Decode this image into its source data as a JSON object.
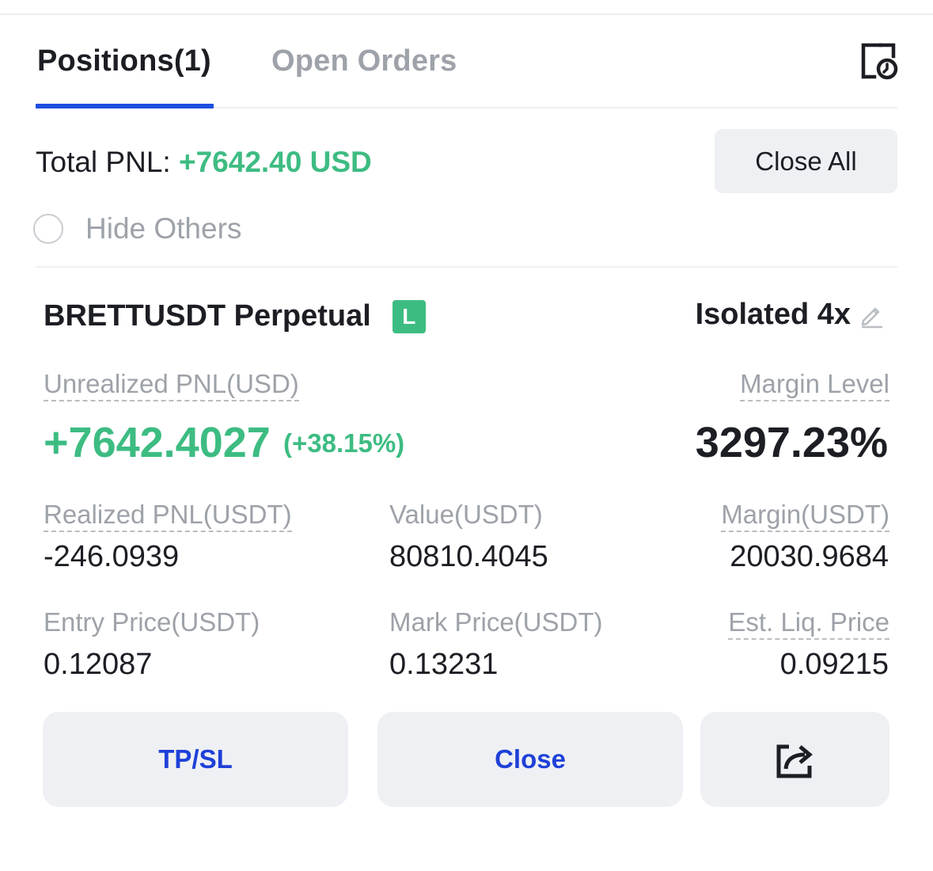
{
  "tabs": [
    {
      "label": "Positions(1)",
      "active": true
    },
    {
      "label": "Open Orders",
      "active": false
    }
  ],
  "summary": {
    "total_pnl_label": "Total PNL: ",
    "total_pnl_value": "+7642.40 USD",
    "close_all_label": "Close All",
    "hide_others_label": "Hide Others",
    "hide_others_checked": false
  },
  "position": {
    "symbol": "BRETTUSDT Perpetual",
    "side_badge": "L",
    "leverage": "Isolated 4x",
    "unrealized_pnl_label": "Unrealized PNL(USD)",
    "unrealized_pnl_value": "+7642.4027",
    "unrealized_pnl_percent": "(+38.15%)",
    "margin_level_label": "Margin Level",
    "margin_level_value": "3297.23%",
    "realized_pnl_label": "Realized PNL(USDT)",
    "realized_pnl_value": "-246.0939",
    "value_label": "Value(USDT)",
    "value_value": "80810.4045",
    "margin_label": "Margin(USDT)",
    "margin_value": "20030.9684",
    "entry_price_label": "Entry Price(USDT)",
    "entry_price_value": "0.12087",
    "mark_price_label": "Mark Price(USDT)",
    "mark_price_value": "0.13231",
    "liq_price_label": "Est. Liq. Price",
    "liq_price_value": "0.09215"
  },
  "actions": {
    "tpsl_label": "TP/SL",
    "close_label": "Close",
    "share_icon": "share-icon"
  },
  "colors": {
    "profit_green": "#3dbc82",
    "accent_blue": "#1e40d8",
    "tab_underline": "#1e4fe0",
    "muted_gray": "#9ea2a9",
    "button_bg": "#eef0f3"
  }
}
